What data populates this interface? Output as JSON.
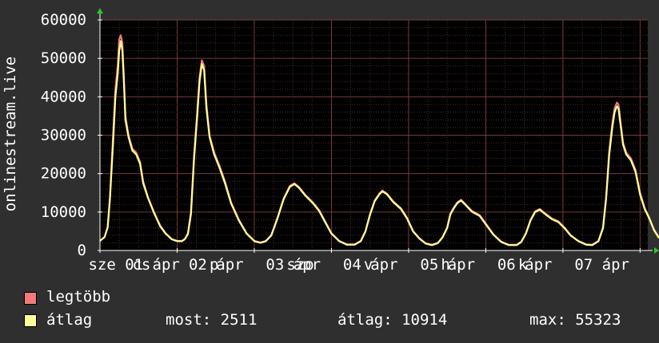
{
  "chart_data": {
    "type": "line",
    "ylabel": "onlinestream.live",
    "ylim": [
      0,
      60000
    ],
    "yticks": [
      "0",
      "10000",
      "20000",
      "30000",
      "40000",
      "50000",
      "60000"
    ],
    "x_day_labels": [
      "sze 01 ápr",
      "csü 02 ápr",
      "pén 03 ápr",
      "szo 04 ápr",
      "vas 05 ápr",
      "hét 06 ápr",
      "kedd 07 ápr"
    ],
    "x_tick_labels": [
      "sze 01 ápr",
      "cs",
      "02 ápr",
      "p",
      "03 ápr",
      "szo",
      "04 ápr",
      "v",
      "05 ápr",
      "h",
      "06 ápr",
      "k",
      "07 ápr"
    ],
    "x_range_days": [
      0,
      7.1
    ],
    "series": [
      {
        "name": "legtöbb",
        "color": "#f07a7e",
        "points": [
          [
            0.0,
            2500
          ],
          [
            0.06,
            3500
          ],
          [
            0.1,
            6000
          ],
          [
            0.13,
            14000
          ],
          [
            0.17,
            30000
          ],
          [
            0.2,
            42000
          ],
          [
            0.23,
            48000
          ],
          [
            0.25,
            55000
          ],
          [
            0.27,
            56000
          ],
          [
            0.29,
            54000
          ],
          [
            0.31,
            45000
          ],
          [
            0.33,
            35000
          ],
          [
            0.37,
            30000
          ],
          [
            0.42,
            26500
          ],
          [
            0.47,
            25500
          ],
          [
            0.52,
            23000
          ],
          [
            0.56,
            18000
          ],
          [
            0.62,
            14000
          ],
          [
            0.7,
            10000
          ],
          [
            0.78,
            6500
          ],
          [
            0.85,
            4500
          ],
          [
            0.93,
            3000
          ],
          [
            1.0,
            2500
          ],
          [
            1.06,
            2500
          ],
          [
            1.1,
            3000
          ],
          [
            1.14,
            4500
          ],
          [
            1.18,
            10000
          ],
          [
            1.22,
            25000
          ],
          [
            1.26,
            36000
          ],
          [
            1.29,
            45000
          ],
          [
            1.32,
            49500
          ],
          [
            1.35,
            48000
          ],
          [
            1.38,
            38000
          ],
          [
            1.42,
            30000
          ],
          [
            1.48,
            25500
          ],
          [
            1.55,
            22000
          ],
          [
            1.62,
            18000
          ],
          [
            1.7,
            12500
          ],
          [
            1.8,
            8000
          ],
          [
            1.9,
            4500
          ],
          [
            2.0,
            2500
          ],
          [
            2.08,
            2100
          ],
          [
            2.15,
            2500
          ],
          [
            2.22,
            4000
          ],
          [
            2.3,
            8500
          ],
          [
            2.38,
            13500
          ],
          [
            2.46,
            16800
          ],
          [
            2.52,
            17500
          ],
          [
            2.58,
            16500
          ],
          [
            2.66,
            14500
          ],
          [
            2.76,
            12500
          ],
          [
            2.84,
            10500
          ],
          [
            2.92,
            7500
          ],
          [
            3.0,
            4500
          ],
          [
            3.1,
            2500
          ],
          [
            3.2,
            1600
          ],
          [
            3.3,
            1600
          ],
          [
            3.38,
            2500
          ],
          [
            3.44,
            5000
          ],
          [
            3.5,
            9500
          ],
          [
            3.56,
            13000
          ],
          [
            3.62,
            14800
          ],
          [
            3.66,
            15600
          ],
          [
            3.72,
            14800
          ],
          [
            3.8,
            12800
          ],
          [
            3.9,
            11000
          ],
          [
            3.98,
            8500
          ],
          [
            4.06,
            5000
          ],
          [
            4.14,
            3200
          ],
          [
            4.22,
            1900
          ],
          [
            4.3,
            1500
          ],
          [
            4.38,
            2000
          ],
          [
            4.44,
            3500
          ],
          [
            4.5,
            6000
          ],
          [
            4.54,
            9500
          ],
          [
            4.58,
            11000
          ],
          [
            4.63,
            12500
          ],
          [
            4.68,
            13200
          ],
          [
            4.74,
            12000
          ],
          [
            4.82,
            10300
          ],
          [
            4.92,
            9200
          ],
          [
            5.0,
            7000
          ],
          [
            5.1,
            4200
          ],
          [
            5.2,
            2300
          ],
          [
            5.3,
            1500
          ],
          [
            5.4,
            1500
          ],
          [
            5.46,
            2300
          ],
          [
            5.52,
            4500
          ],
          [
            5.58,
            8000
          ],
          [
            5.64,
            10200
          ],
          [
            5.7,
            10800
          ],
          [
            5.78,
            9500
          ],
          [
            5.86,
            8300
          ],
          [
            5.94,
            7600
          ],
          [
            6.02,
            6000
          ],
          [
            6.1,
            4000
          ],
          [
            6.2,
            2500
          ],
          [
            6.3,
            1600
          ],
          [
            6.38,
            1500
          ],
          [
            6.46,
            2500
          ],
          [
            6.52,
            6000
          ],
          [
            6.56,
            14000
          ],
          [
            6.6,
            26000
          ],
          [
            6.64,
            33000
          ],
          [
            6.67,
            37000
          ],
          [
            6.7,
            38500
          ],
          [
            6.72,
            38000
          ],
          [
            6.78,
            28000
          ],
          [
            6.82,
            25500
          ],
          [
            6.88,
            24000
          ],
          [
            6.94,
            21000
          ],
          [
            7.0,
            15000
          ],
          [
            7.06,
            11000
          ],
          [
            7.12,
            8500
          ],
          [
            7.18,
            5500
          ],
          [
            7.24,
            3500
          ],
          [
            7.32,
            2400
          ],
          [
            7.38,
            2300
          ]
        ]
      },
      {
        "name": "átlag",
        "color": "#ffff99",
        "points": [
          [
            0.0,
            2500
          ],
          [
            0.06,
            3500
          ],
          [
            0.1,
            6000
          ],
          [
            0.13,
            13500
          ],
          [
            0.17,
            28000
          ],
          [
            0.2,
            40000
          ],
          [
            0.23,
            46000
          ],
          [
            0.25,
            52000
          ],
          [
            0.27,
            54500
          ],
          [
            0.29,
            52000
          ],
          [
            0.31,
            44000
          ],
          [
            0.33,
            34000
          ],
          [
            0.37,
            29500
          ],
          [
            0.42,
            26000
          ],
          [
            0.47,
            25000
          ],
          [
            0.52,
            22500
          ],
          [
            0.56,
            17500
          ],
          [
            0.62,
            13800
          ],
          [
            0.7,
            9800
          ],
          [
            0.78,
            6300
          ],
          [
            0.85,
            4400
          ],
          [
            0.93,
            2900
          ],
          [
            1.0,
            2400
          ],
          [
            1.06,
            2400
          ],
          [
            1.1,
            2900
          ],
          [
            1.14,
            4300
          ],
          [
            1.18,
            9500
          ],
          [
            1.22,
            24000
          ],
          [
            1.26,
            35000
          ],
          [
            1.29,
            44000
          ],
          [
            1.32,
            48500
          ],
          [
            1.35,
            47000
          ],
          [
            1.38,
            37000
          ],
          [
            1.42,
            29500
          ],
          [
            1.48,
            25000
          ],
          [
            1.55,
            21500
          ],
          [
            1.62,
            17500
          ],
          [
            1.7,
            12200
          ],
          [
            1.8,
            7800
          ],
          [
            1.9,
            4400
          ],
          [
            2.0,
            2400
          ],
          [
            2.08,
            2000
          ],
          [
            2.15,
            2400
          ],
          [
            2.22,
            3900
          ],
          [
            2.3,
            8300
          ],
          [
            2.38,
            13300
          ],
          [
            2.46,
            16500
          ],
          [
            2.52,
            17300
          ],
          [
            2.58,
            16300
          ],
          [
            2.66,
            14300
          ],
          [
            2.76,
            12300
          ],
          [
            2.84,
            10300
          ],
          [
            2.92,
            7300
          ],
          [
            3.0,
            4400
          ],
          [
            3.1,
            2400
          ],
          [
            3.2,
            1500
          ],
          [
            3.3,
            1500
          ],
          [
            3.38,
            2400
          ],
          [
            3.44,
            4900
          ],
          [
            3.5,
            9300
          ],
          [
            3.56,
            12800
          ],
          [
            3.62,
            14600
          ],
          [
            3.66,
            15400
          ],
          [
            3.72,
            14600
          ],
          [
            3.8,
            12600
          ],
          [
            3.9,
            10800
          ],
          [
            3.98,
            8300
          ],
          [
            4.06,
            4900
          ],
          [
            4.14,
            3100
          ],
          [
            4.22,
            1800
          ],
          [
            4.3,
            1400
          ],
          [
            4.38,
            1900
          ],
          [
            4.44,
            3400
          ],
          [
            4.5,
            5900
          ],
          [
            4.54,
            9300
          ],
          [
            4.58,
            10800
          ],
          [
            4.63,
            12300
          ],
          [
            4.68,
            13000
          ],
          [
            4.74,
            11800
          ],
          [
            4.82,
            10100
          ],
          [
            4.92,
            9000
          ],
          [
            5.0,
            6800
          ],
          [
            5.1,
            4100
          ],
          [
            5.2,
            2200
          ],
          [
            5.3,
            1400
          ],
          [
            5.4,
            1400
          ],
          [
            5.46,
            2200
          ],
          [
            5.52,
            4400
          ],
          [
            5.58,
            7800
          ],
          [
            5.64,
            10000
          ],
          [
            5.7,
            10600
          ],
          [
            5.78,
            9300
          ],
          [
            5.86,
            8100
          ],
          [
            5.94,
            7400
          ],
          [
            6.02,
            5800
          ],
          [
            6.1,
            3900
          ],
          [
            6.2,
            2400
          ],
          [
            6.3,
            1500
          ],
          [
            6.38,
            1400
          ],
          [
            6.46,
            2400
          ],
          [
            6.52,
            5800
          ],
          [
            6.56,
            13500
          ],
          [
            6.6,
            25000
          ],
          [
            6.64,
            32000
          ],
          [
            6.67,
            36000
          ],
          [
            6.7,
            37500
          ],
          [
            6.72,
            37000
          ],
          [
            6.78,
            27500
          ],
          [
            6.82,
            25000
          ],
          [
            6.88,
            23500
          ],
          [
            6.94,
            20500
          ],
          [
            7.0,
            14500
          ],
          [
            7.06,
            10800
          ],
          [
            7.12,
            8300
          ],
          [
            7.18,
            5300
          ],
          [
            7.24,
            3400
          ],
          [
            7.32,
            2400
          ],
          [
            7.38,
            2300
          ]
        ]
      }
    ]
  },
  "legend": [
    {
      "label": "legtöbb",
      "color": "#f07a7e"
    },
    {
      "label": "átlag",
      "color": "#ffff99"
    }
  ],
  "stats": {
    "most": "most: 2511",
    "atlag": "átlag: 10914",
    "max": "max: 55323"
  },
  "colors": {
    "background": "#2f2f2f",
    "plot_background": "#000000",
    "grid_minor": "#4a2a2a",
    "grid_major": "#7a3a3a",
    "axis": "#ffffff",
    "arrow": "#22cc22"
  }
}
